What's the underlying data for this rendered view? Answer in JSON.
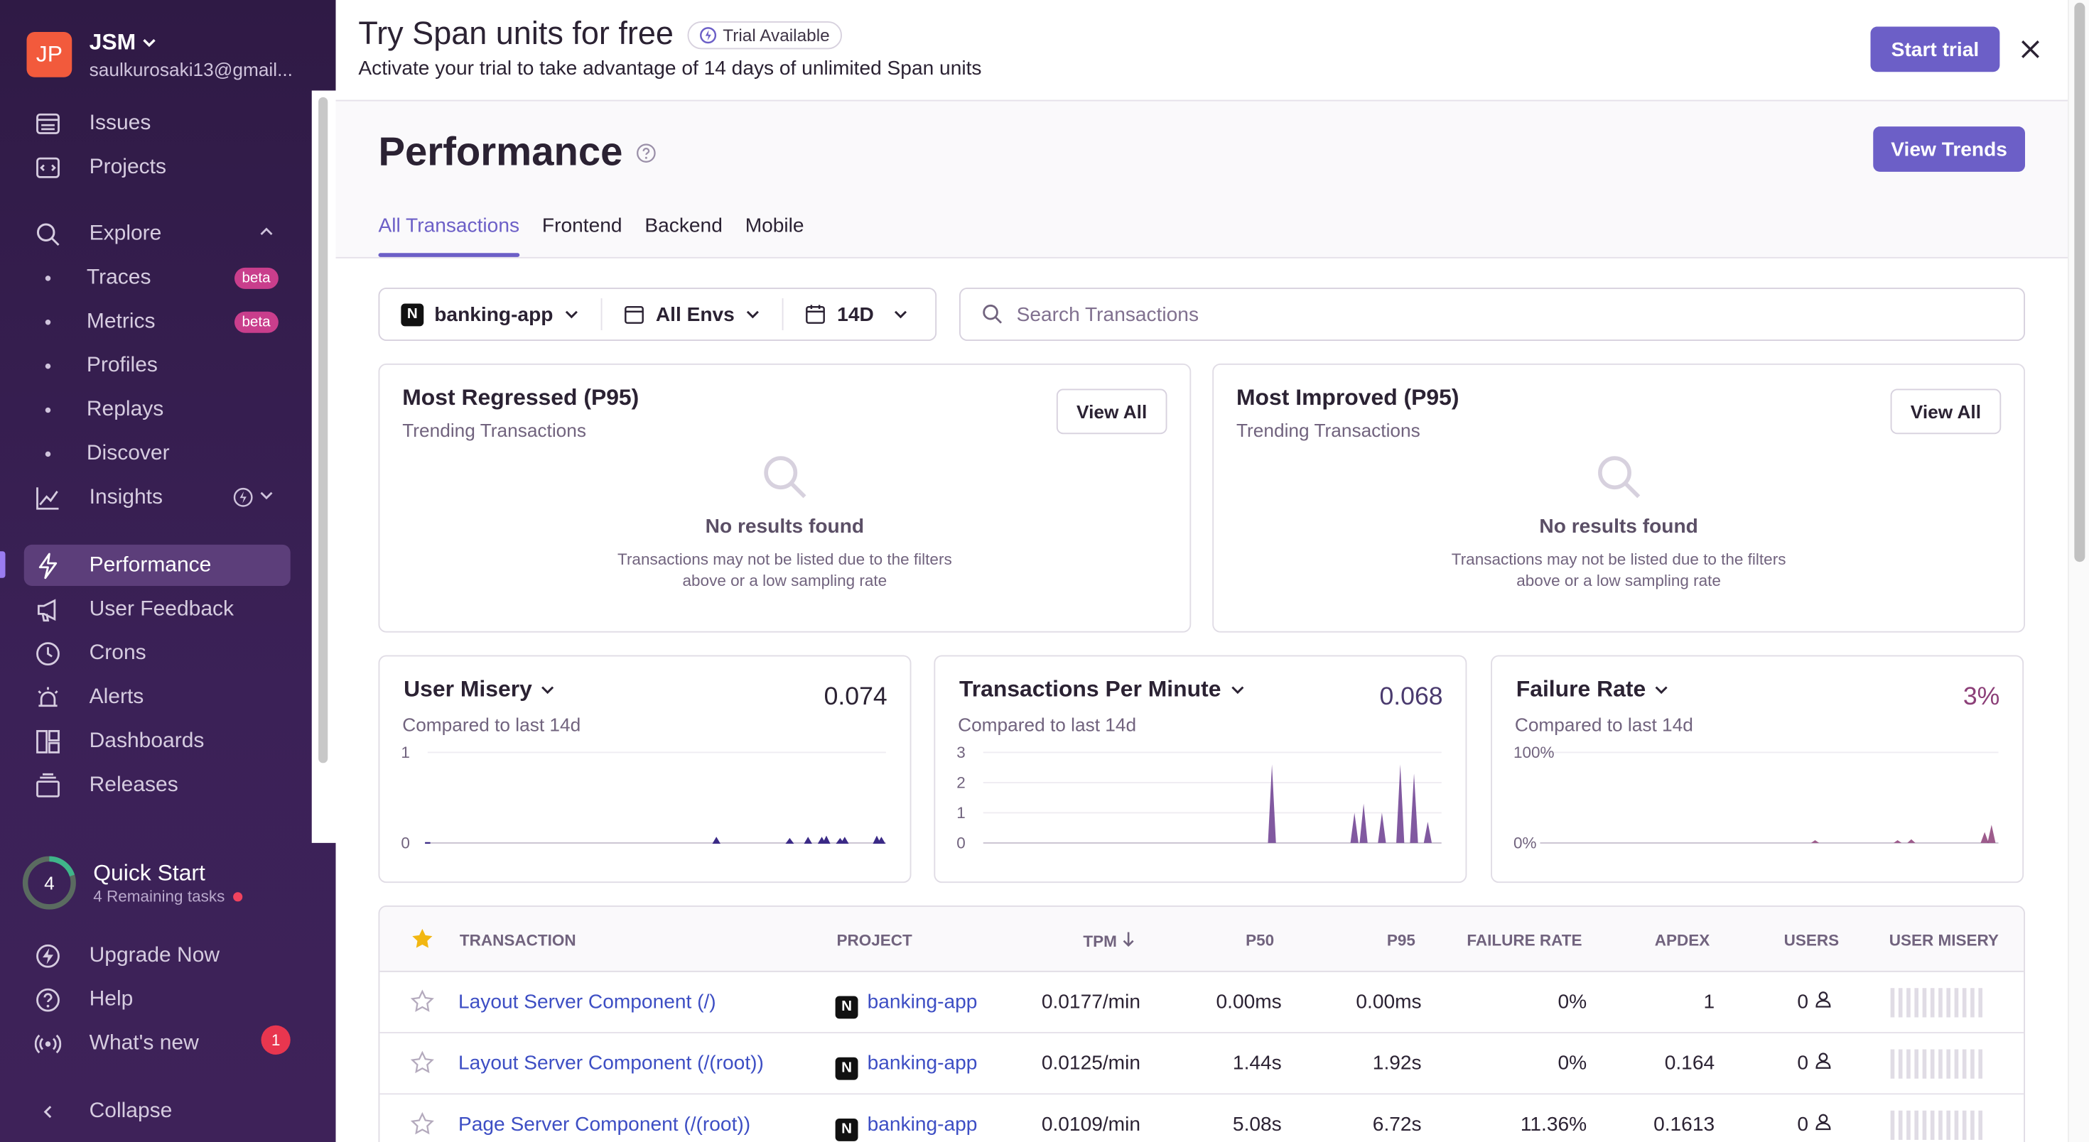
{
  "org": {
    "initials": "JP",
    "name": "JSM",
    "email": "saulkurosaki13@gmail..."
  },
  "sidebar": {
    "items": [
      {
        "label": "Issues"
      },
      {
        "label": "Projects"
      },
      {
        "label": "Explore"
      },
      {
        "label": "Traces",
        "badge": "beta"
      },
      {
        "label": "Metrics",
        "badge": "beta"
      },
      {
        "label": "Profiles"
      },
      {
        "label": "Replays"
      },
      {
        "label": "Discover"
      },
      {
        "label": "Insights"
      },
      {
        "label": "Performance"
      },
      {
        "label": "User Feedback"
      },
      {
        "label": "Crons"
      },
      {
        "label": "Alerts"
      },
      {
        "label": "Dashboards"
      },
      {
        "label": "Releases"
      }
    ],
    "quick_start": {
      "count": "4",
      "title": "Quick Start",
      "subtitle": "4 Remaining tasks",
      "progress": 0.2
    },
    "footer": [
      {
        "label": "Upgrade Now"
      },
      {
        "label": "Help"
      },
      {
        "label": "What's new",
        "count": "1"
      },
      {
        "label": "Collapse"
      }
    ]
  },
  "banner": {
    "title": "Try Span units for free",
    "badge": "Trial Available",
    "subtitle": "Activate your trial to take advantage of 14 days of unlimited Span units",
    "start_button": "Start trial"
  },
  "page": {
    "title": "Performance",
    "trends_button": "View Trends",
    "tabs": [
      {
        "label": "All Transactions"
      },
      {
        "label": "Frontend"
      },
      {
        "label": "Backend"
      },
      {
        "label": "Mobile"
      }
    ]
  },
  "filters": {
    "project": "banking-app",
    "env": "All Envs",
    "period": "14D",
    "search_placeholder": "Search Transactions"
  },
  "trend_cards": [
    {
      "title": "Most Regressed (P95)",
      "subtitle": "Trending Transactions",
      "button": "View All",
      "empty_title": "No results found",
      "empty_desc_1": "Transactions may not be listed due to the filters",
      "empty_desc_2": "above or a low sampling rate"
    },
    {
      "title": "Most Improved (P95)",
      "subtitle": "Trending Transactions",
      "button": "View All",
      "empty_title": "No results found",
      "empty_desc_1": "Transactions may not be listed due to the filters",
      "empty_desc_2": "above or a low sampling rate"
    }
  ],
  "metric_cards": [
    {
      "title": "User Misery",
      "value": "0.074",
      "subtitle": "Compared to last 14d",
      "value_color": "#2b2233"
    },
    {
      "title": "Transactions Per Minute",
      "value": "0.068",
      "subtitle": "Compared to last 14d",
      "value_color": "#4a3a6e"
    },
    {
      "title": "Failure Rate",
      "value": "3%",
      "subtitle": "Compared to last 14d",
      "value_color": "#8c3f78"
    }
  ],
  "chart_data": [
    {
      "type": "line",
      "title": "User Misery",
      "y_ticks": [
        "0",
        "1"
      ],
      "ylim": [
        0,
        1
      ],
      "x": [
        0,
        0.63,
        0.79,
        0.83,
        0.86,
        0.87,
        0.9,
        0.91,
        0.98,
        0.99
      ],
      "values": [
        0,
        0.05,
        0.04,
        0.05,
        0.05,
        0.06,
        0.04,
        0.05,
        0.06,
        0.05
      ],
      "color": "#3b2a86"
    },
    {
      "type": "area",
      "title": "Transactions Per Minute",
      "y_ticks": [
        "0",
        "1",
        "2",
        "3"
      ],
      "ylim": [
        0,
        3
      ],
      "x": [
        0.63,
        0.81,
        0.83,
        0.87,
        0.91,
        0.94,
        0.97
      ],
      "values": [
        2.6,
        1.0,
        1.3,
        1.0,
        2.6,
        2.3,
        0.7
      ],
      "color": "#6b3c8f"
    },
    {
      "type": "area",
      "title": "Failure Rate",
      "y_ticks": [
        "0%",
        "100%"
      ],
      "ylim": [
        0,
        100
      ],
      "x": [
        0.6,
        0.78,
        0.81,
        0.97,
        0.985
      ],
      "values": [
        3,
        3,
        4,
        12,
        20
      ],
      "color": "#8c3f78"
    }
  ],
  "table": {
    "headers": [
      "TRANSACTION",
      "PROJECT",
      "TPM",
      "P50",
      "P95",
      "FAILURE RATE",
      "APDEX",
      "USERS",
      "USER MISERY"
    ],
    "rows": [
      {
        "transaction": "Layout Server Component (/)",
        "project": "banking-app",
        "tpm": "0.0177/min",
        "p50": "0.00ms",
        "p95": "0.00ms",
        "failure_rate": "0%",
        "apdex": "1",
        "users": "0"
      },
      {
        "transaction": "Layout Server Component (/(root))",
        "project": "banking-app",
        "tpm": "0.0125/min",
        "p50": "1.44s",
        "p95": "1.92s",
        "failure_rate": "0%",
        "apdex": "0.164",
        "users": "0"
      },
      {
        "transaction": "Page Server Component (/(root))",
        "project": "banking-app",
        "tpm": "0.0109/min",
        "p50": "5.08s",
        "p95": "6.72s",
        "failure_rate": "11.36%",
        "apdex": "0.1613",
        "users": "0"
      }
    ]
  }
}
